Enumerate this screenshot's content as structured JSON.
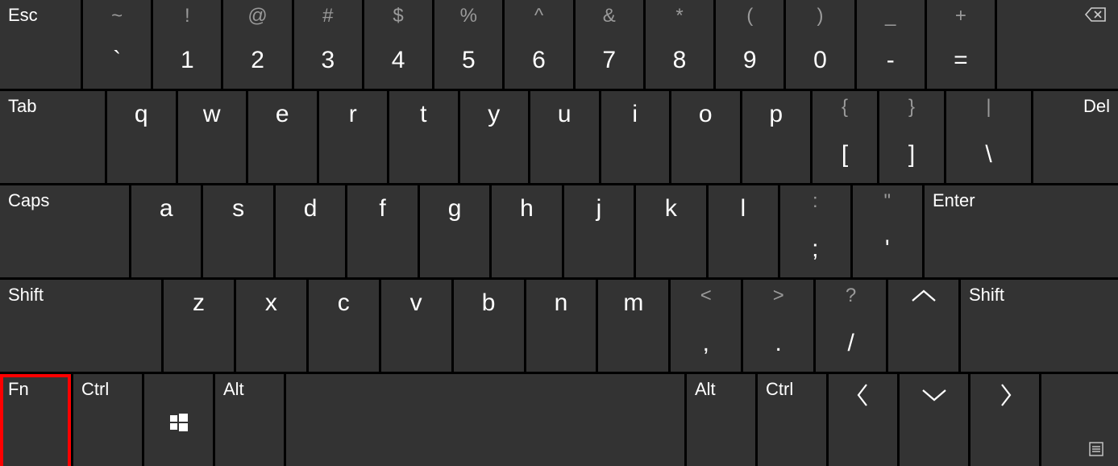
{
  "row0": {
    "esc": "Esc",
    "keys": [
      {
        "upper": "~",
        "lower": "`"
      },
      {
        "upper": "!",
        "lower": "1"
      },
      {
        "upper": "@",
        "lower": "2"
      },
      {
        "upper": "#",
        "lower": "3"
      },
      {
        "upper": "$",
        "lower": "4"
      },
      {
        "upper": "%",
        "lower": "5"
      },
      {
        "upper": "^",
        "lower": "6"
      },
      {
        "upper": "&",
        "lower": "7"
      },
      {
        "upper": "*",
        "lower": "8"
      },
      {
        "upper": "(",
        "lower": "9"
      },
      {
        "upper": ")",
        "lower": "0"
      },
      {
        "upper": "_",
        "lower": "-"
      },
      {
        "upper": "+",
        "lower": "="
      }
    ],
    "backspace_icon": "⌫"
  },
  "row1": {
    "tab": "Tab",
    "letters": [
      "q",
      "w",
      "e",
      "r",
      "t",
      "y",
      "u",
      "i",
      "o",
      "p"
    ],
    "br1": {
      "upper": "{",
      "lower": "["
    },
    "br2": {
      "upper": "}",
      "lower": "]"
    },
    "bslash": {
      "upper": "|",
      "lower": "\\"
    },
    "del": "Del"
  },
  "row2": {
    "caps": "Caps",
    "letters": [
      "a",
      "s",
      "d",
      "f",
      "g",
      "h",
      "j",
      "k",
      "l"
    ],
    "semi": {
      "upper": ":",
      "lower": ";"
    },
    "quote": {
      "upper": "\"",
      "lower": "'"
    },
    "enter": "Enter"
  },
  "row3": {
    "shift": "Shift",
    "letters": [
      "z",
      "x",
      "c",
      "v",
      "b",
      "n",
      "m"
    ],
    "comma": {
      "upper": "<",
      "lower": ","
    },
    "period": {
      "upper": ">",
      "lower": "."
    },
    "slash": {
      "upper": "?",
      "lower": "/"
    },
    "up_icon": "up-arrow",
    "shift_r": "Shift"
  },
  "row4": {
    "fn": "Fn",
    "ctrl": "Ctrl",
    "win_icon": "windows-logo",
    "alt": "Alt",
    "space": "",
    "alt_r": "Alt",
    "ctrl_r": "Ctrl",
    "left_icon": "left-arrow",
    "down_icon": "down-arrow",
    "right_icon": "right-arrow",
    "menu_icon": "menu"
  }
}
